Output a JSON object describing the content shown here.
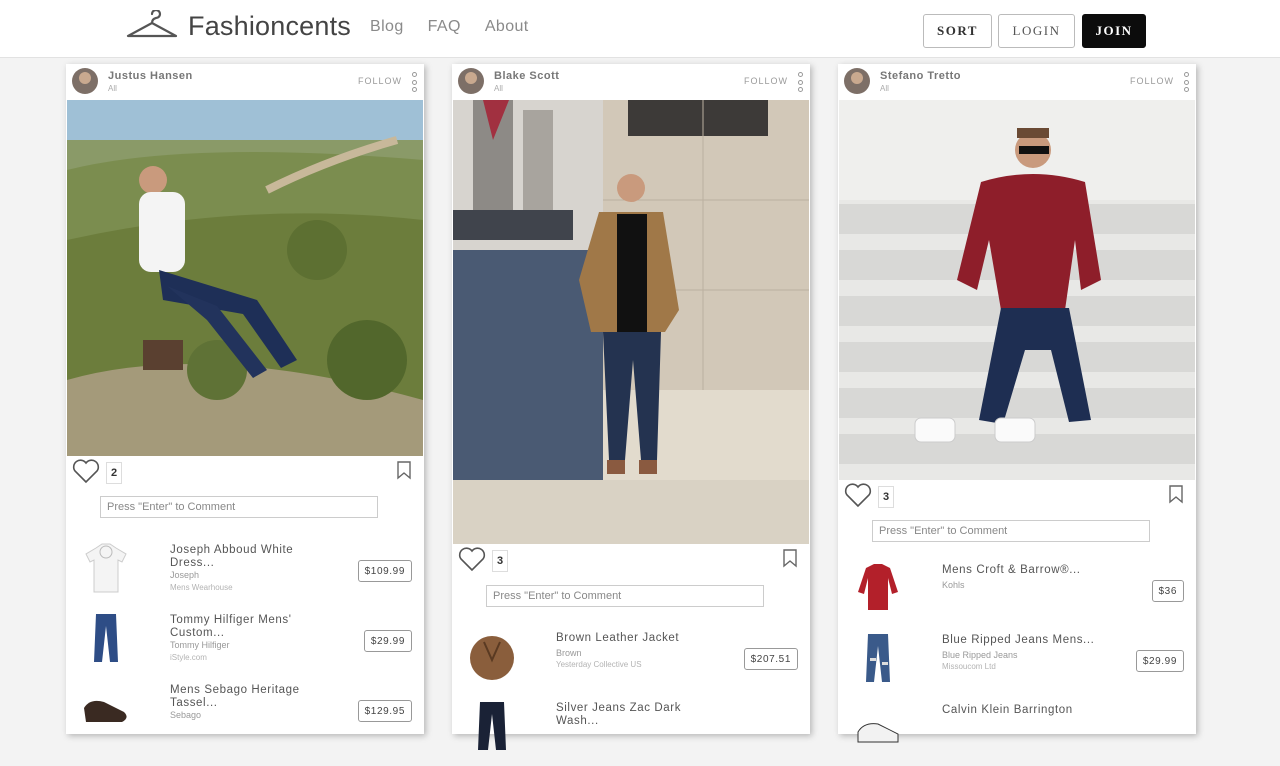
{
  "header": {
    "logo": "Fashioncents",
    "nav": [
      "Blog",
      "FAQ",
      "About"
    ],
    "sort_label": "SORT",
    "login_label": "LOGIN",
    "join_label": "JOIN"
  },
  "cards": [
    {
      "user": "Justus Hansen",
      "user_sub": "All",
      "follow": "FOLLOW",
      "likes": "2",
      "comment_placeholder": "Press \"Enter\" to Comment",
      "products": [
        {
          "title": "Joseph Abboud White Dress...",
          "brand": "Joseph",
          "store": "Mens Wearhouse",
          "price": "$109.99",
          "icon": "white-shirt-icon"
        },
        {
          "title": "Tommy Hilfiger Mens' Custom...",
          "brand": "Tommy Hilfiger",
          "store": "iStyle.com",
          "price": "$29.99",
          "icon": "jeans-icon"
        },
        {
          "title": "Mens Sebago Heritage Tassel...",
          "brand": "Sebago",
          "store": "",
          "price": "$129.95",
          "icon": "loafer-icon"
        }
      ]
    },
    {
      "user": "Blake Scott",
      "user_sub": "All",
      "follow": "FOLLOW",
      "likes": "3",
      "comment_placeholder": "Press \"Enter\" to Comment",
      "products": [
        {
          "title": "Brown Leather Jacket",
          "brand": "Brown",
          "store": "Yesterday Collective US",
          "price": "$207.51",
          "icon": "leather-jacket-icon"
        },
        {
          "title": "Silver Jeans Zac Dark Wash...",
          "brand": "",
          "store": "",
          "price": "",
          "icon": "dark-jeans-icon"
        }
      ]
    },
    {
      "user": "Stefano Tretto",
      "user_sub": "All",
      "follow": "FOLLOW",
      "likes": "3",
      "comment_placeholder": "Press \"Enter\" to Comment",
      "products": [
        {
          "title": "Mens Croft & Barrow®...",
          "brand": "Kohls",
          "store": "",
          "price": "$36",
          "icon": "red-sweater-icon"
        },
        {
          "title": "Blue Ripped Jeans Mens...",
          "brand": "Blue Ripped Jeans",
          "store": "Missoucom Ltd",
          "price": "$29.99",
          "icon": "ripped-jeans-icon"
        },
        {
          "title": "Calvin Klein Barrington",
          "brand": "",
          "store": "",
          "price": "",
          "icon": "sneaker-icon"
        }
      ]
    }
  ],
  "colors": {
    "join_bg": "#0c0c0c",
    "accent_gray": "#8a8a8a"
  }
}
